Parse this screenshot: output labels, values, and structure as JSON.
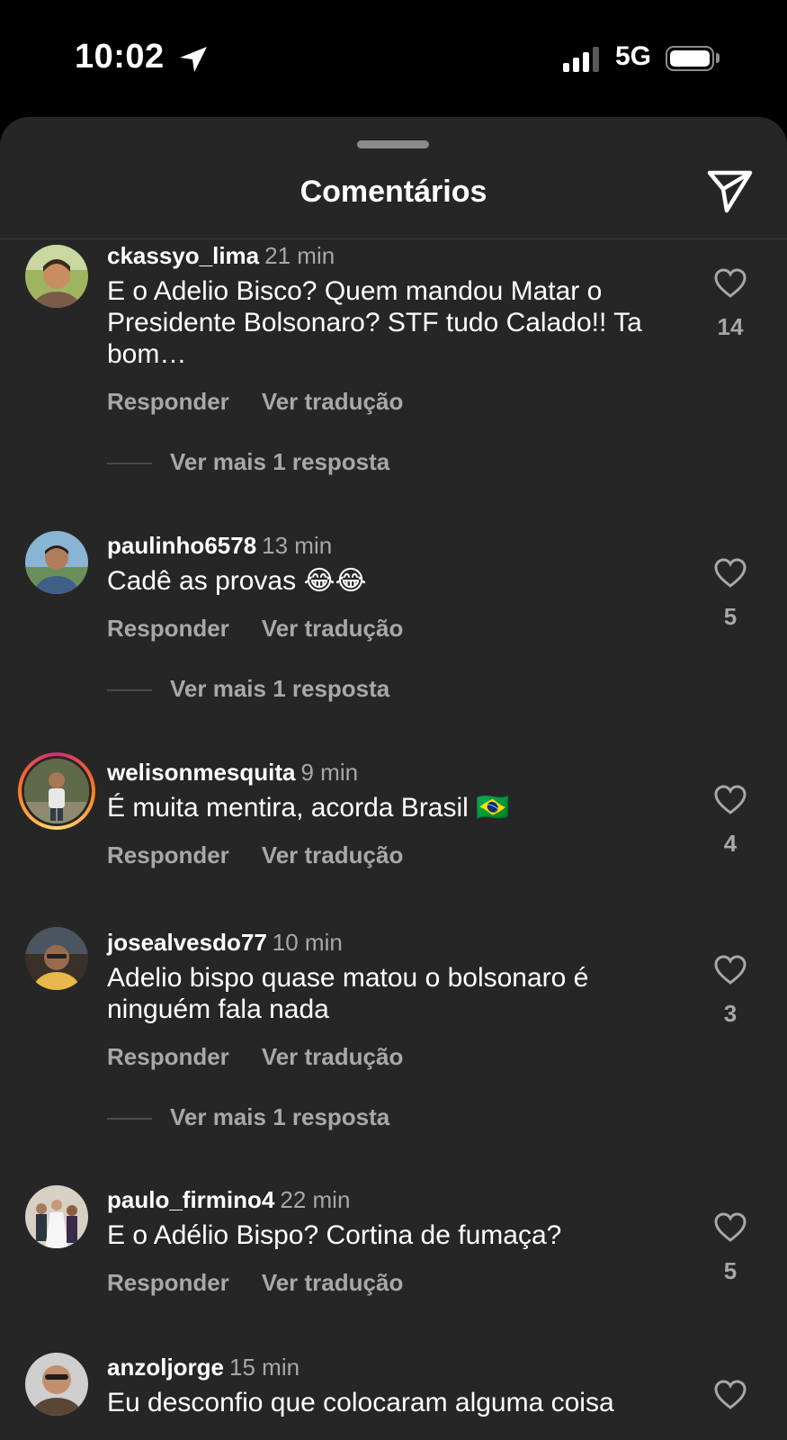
{
  "status_bar": {
    "time": "10:02",
    "network": "5G",
    "location_icon": "location-arrow-icon",
    "signal_icon": "signal-bars-icon",
    "battery_icon": "battery-icon"
  },
  "header": {
    "title": "Comentários",
    "share_icon": "send-icon"
  },
  "labels": {
    "reply": "Responder",
    "translate": "Ver tradução"
  },
  "comments": [
    {
      "username": "ckassyo_lima",
      "time": "21 min",
      "text": "E o Adelio Bisco? Quem mandou Matar o Presidente Bolsonaro? STF tudo Calado!! Ta bom…",
      "likes": "14",
      "replies_label": "Ver mais 1 resposta"
    },
    {
      "username": "paulinho6578",
      "time": "13 min",
      "text": "Cadê as provas 😂😂",
      "likes": "5",
      "replies_label": "Ver mais 1 resposta"
    },
    {
      "username": "welisonmesquita",
      "time": "9 min",
      "text": "É muita mentira, acorda Brasil 🇧🇷",
      "likes": "4",
      "has_story": true
    },
    {
      "username": "josealvesdo77",
      "time": "10 min",
      "text": "Adelio bispo quase matou o bolsonaro é ninguém fala nada",
      "likes": "3",
      "replies_label": "Ver mais 1 resposta"
    },
    {
      "username": "paulo_firmino4",
      "time": "22 min",
      "text": "E o Adélio Bispo? Cortina de fumaça?",
      "likes": "5"
    },
    {
      "username": "anzoljorge",
      "time": "15 min",
      "text": "Eu desconfio que colocaram alguma coisa"
    }
  ]
}
